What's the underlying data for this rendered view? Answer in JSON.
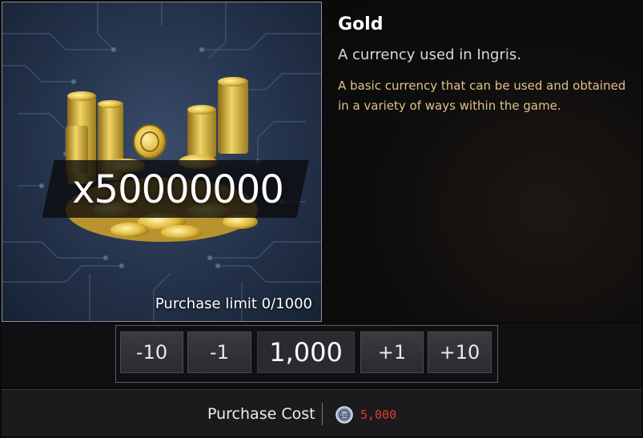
{
  "item": {
    "quantity_label": "x50000000",
    "purchase_limit": "Purchase limit 0/1000",
    "name": "Gold",
    "short_description": "A currency used in Ingris.",
    "long_description": "A basic currency that can be used and obtained in a variety of ways within the game."
  },
  "stepper": {
    "minus10": "-10",
    "minus1": "-1",
    "value": "1,000",
    "plus1": "+1",
    "plus10": "+10"
  },
  "cost": {
    "label": "Purchase Cost",
    "currency_icon": "coin-icon",
    "value": "5,000",
    "value_color": "#e23b2f"
  },
  "colors": {
    "accent_gold": "#e0c28a",
    "panel_blue": "#24324a"
  }
}
